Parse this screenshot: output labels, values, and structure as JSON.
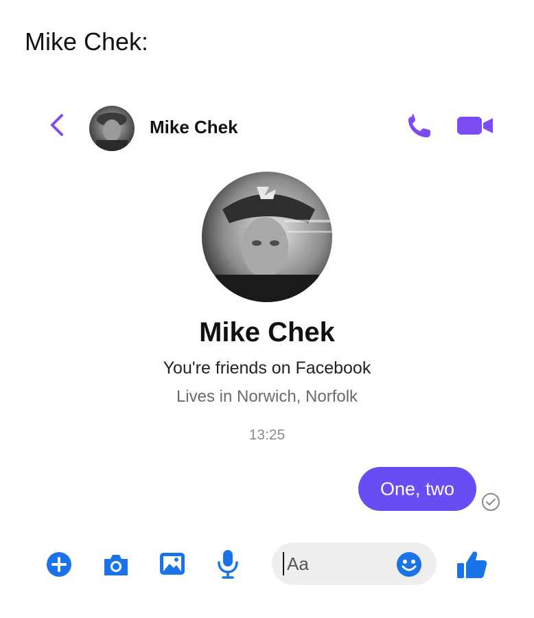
{
  "caption": "Mike Chek:",
  "header": {
    "name": "Mike Chek"
  },
  "profile": {
    "name": "Mike Chek",
    "friends_text": "You're friends on Facebook",
    "lives_text": "Lives in Norwich, Norfolk"
  },
  "thread": {
    "timestamp": "13:25",
    "messages": [
      {
        "text": "One, two",
        "from": "me",
        "status": "sent"
      }
    ]
  },
  "composer": {
    "placeholder": "Aa"
  },
  "colors": {
    "accent": "#6a4cf5",
    "icon_blue": "#1a73e8",
    "icon_purple": "#7b4cf5"
  },
  "icons": {
    "header": [
      "back-chevron-icon",
      "phone-icon",
      "video-camera-icon"
    ],
    "toolbar": [
      "plus-icon",
      "camera-icon",
      "image-icon",
      "microphone-icon",
      "emoji-icon",
      "thumbs-up-icon"
    ],
    "status": "sent-check-icon"
  }
}
